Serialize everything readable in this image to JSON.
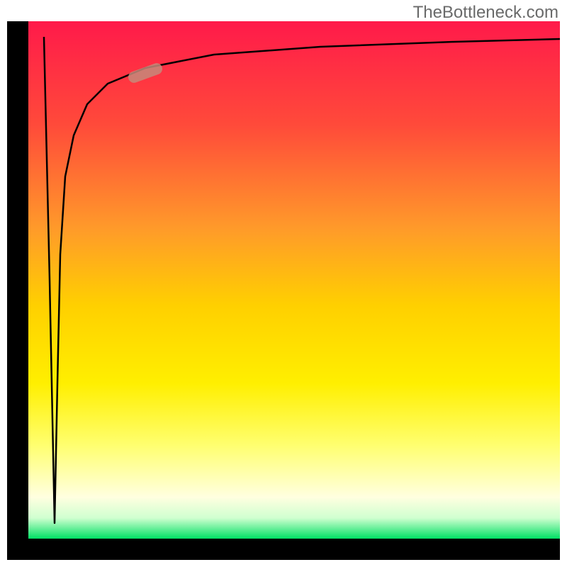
{
  "watermark": "TheBottleneck.com",
  "chart_data": {
    "type": "line",
    "title": "",
    "xlabel": "",
    "ylabel": "",
    "xlim": [
      0,
      100
    ],
    "ylim": [
      0,
      100
    ],
    "background_gradient": {
      "top": "#ff1a4a",
      "mid_upper": "#ff8c3a",
      "mid": "#ffe000",
      "mid_lower": "#ffff66",
      "lower": "#ffffcc",
      "bottom": "#00e064"
    },
    "series": [
      {
        "name": "bottleneck-curve",
        "description": "Curve starting at top-left boundary, dipping sharply to bottom near x≈5, then rising steeply and leveling off near top-right",
        "points": [
          {
            "x": 3.0,
            "y": 97.0
          },
          {
            "x": 4.0,
            "y": 50.0
          },
          {
            "x": 5.0,
            "y": 3.0
          },
          {
            "x": 5.5,
            "y": 30.0
          },
          {
            "x": 6.0,
            "y": 55.0
          },
          {
            "x": 7.0,
            "y": 70.0
          },
          {
            "x": 8.5,
            "y": 78.0
          },
          {
            "x": 11.0,
            "y": 84.0
          },
          {
            "x": 15.0,
            "y": 88.0
          },
          {
            "x": 22.0,
            "y": 91.0
          },
          {
            "x": 35.0,
            "y": 93.5
          },
          {
            "x": 55.0,
            "y": 95.0
          },
          {
            "x": 80.0,
            "y": 96.0
          },
          {
            "x": 100.0,
            "y": 96.5
          }
        ]
      }
    ],
    "marker": {
      "x": 22,
      "y": 90,
      "color": "#c68a7a",
      "shape": "pill"
    },
    "axes": {
      "left_border": true,
      "bottom_border": true,
      "color": "#000000",
      "width": 30
    }
  }
}
